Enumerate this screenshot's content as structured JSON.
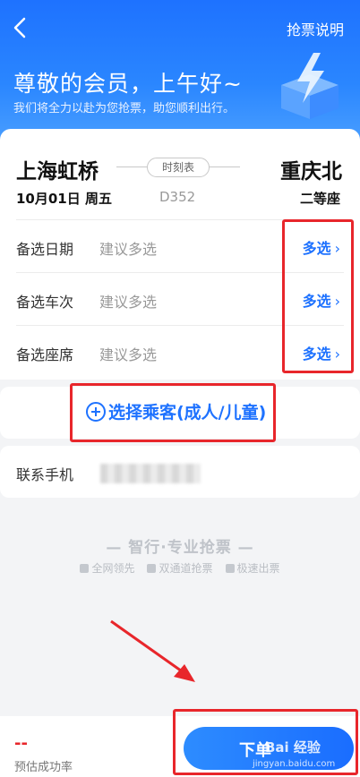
{
  "header": {
    "help_label": "抢票说明",
    "greeting": "尊敬的会员，上午好~",
    "subtitle": "我们将全力以赴为您抢票，助您顺利出行。"
  },
  "trip": {
    "from": "上海虹桥",
    "to": "重庆北",
    "timetable_label": "时刻表",
    "date": "10月01日 周五",
    "train_no": "D352",
    "seat_class": "二等座"
  },
  "options": [
    {
      "label": "备选日期",
      "hint": "建议多选",
      "action": "多选"
    },
    {
      "label": "备选车次",
      "hint": "建议多选",
      "action": "多选"
    },
    {
      "label": "备选座席",
      "hint": "建议多选",
      "action": "多选"
    }
  ],
  "passenger": {
    "button_label": "选择乘客(成人/儿童)"
  },
  "contact": {
    "label": "联系手机"
  },
  "brand": {
    "title": "— 智行·专业抢票 —",
    "features": [
      "全网领先",
      "双通道抢票",
      "极速出票"
    ]
  },
  "footer": {
    "success_value": "--",
    "success_label": "预估成功率",
    "submit_label": "下单",
    "watermark": "Bai 经验",
    "watermark_url": "jingyan.baidu.com"
  },
  "colors": {
    "accent": "#1e72ff",
    "highlight": "#e8262b"
  }
}
